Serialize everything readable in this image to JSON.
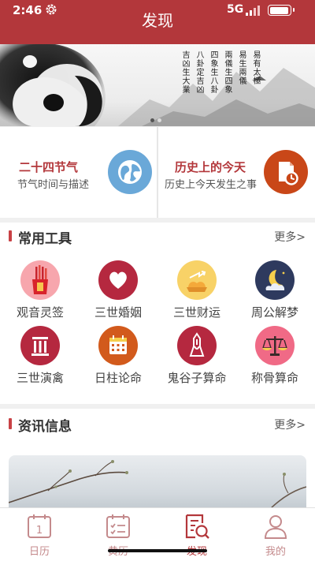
{
  "status_bar": {
    "time": "2:46",
    "network": "5G"
  },
  "header": {
    "title": "发现"
  },
  "banner": {
    "poem_columns": [
      "易有太極",
      "易生兩儀",
      "兩儀生四象",
      "四象生八卦",
      "八卦定吉凶",
      "吉凶生大業"
    ],
    "page_count": 2,
    "active_page": 1
  },
  "features": [
    {
      "title": "二十四节气",
      "subtitle": "节气时间与描述",
      "icon": "globe-icon",
      "color": "#6aa8d8"
    },
    {
      "title": "历史上的今天",
      "subtitle": "历史上今天发生之事",
      "icon": "calendar-clock-icon",
      "color": "#c94718"
    }
  ],
  "tools": {
    "title": "常用工具",
    "more": "更多>",
    "items": [
      {
        "label": "观音灵签",
        "icon": "fortune-sticks-icon",
        "color": "#f7a6ad"
      },
      {
        "label": "三世婚姻",
        "icon": "heart-icon",
        "color": "#b5283f"
      },
      {
        "label": "三世财运",
        "icon": "gold-ingot-icon",
        "color": "#f8d267"
      },
      {
        "label": "周公解梦",
        "icon": "moon-cloud-icon",
        "color": "#2e3a5e"
      },
      {
        "label": "三世演禽",
        "icon": "pillar-icon",
        "color": "#b5283f"
      },
      {
        "label": "日柱论命",
        "icon": "calendar-icon",
        "color": "#d25a1c"
      },
      {
        "label": "鬼谷子算命",
        "icon": "master-icon",
        "color": "#b5283f"
      },
      {
        "label": "称骨算命",
        "icon": "scale-icon",
        "color": "#f06a86"
      }
    ]
  },
  "news": {
    "title": "资讯信息",
    "more": "更多>"
  },
  "tabbar": {
    "tabs": [
      {
        "label": "日历",
        "icon": "calendar-day-icon",
        "active": false
      },
      {
        "label": "黄历",
        "icon": "almanac-icon",
        "active": false
      },
      {
        "label": "发现",
        "icon": "discover-icon",
        "active": true
      },
      {
        "label": "我的",
        "icon": "profile-icon",
        "active": false
      }
    ]
  },
  "calendar_day": "1",
  "colors": {
    "brand": "#b3373b",
    "accent": "#c84145"
  }
}
